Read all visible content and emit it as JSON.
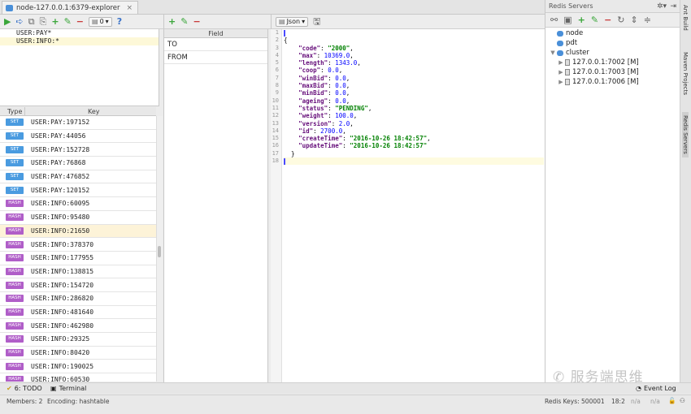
{
  "tab": {
    "title": "node-127.0.0.1:6379-explorer",
    "close": "×"
  },
  "left_toolbar": {
    "db_value": "0"
  },
  "patterns": [
    "USER:PAY*",
    "USER:INFO:*"
  ],
  "key_table": {
    "col_type": "Type",
    "col_key": "Key",
    "rows": [
      {
        "type": "SET",
        "key": "USER:PAY:197152"
      },
      {
        "type": "SET",
        "key": "USER:PAY:44056"
      },
      {
        "type": "SET",
        "key": "USER:PAY:152728"
      },
      {
        "type": "SET",
        "key": "USER:PAY:76868"
      },
      {
        "type": "SET",
        "key": "USER:PAY:476852"
      },
      {
        "type": "SET",
        "key": "USER:PAY:120152"
      },
      {
        "type": "HASH",
        "key": "USER:INFO:60095"
      },
      {
        "type": "HASH",
        "key": "USER:INFO:95480"
      },
      {
        "type": "HASH",
        "key": "USER:INFO:21650"
      },
      {
        "type": "HASH",
        "key": "USER:INFO:378370"
      },
      {
        "type": "HASH",
        "key": "USER:INFO:177955"
      },
      {
        "type": "HASH",
        "key": "USER:INFO:138815"
      },
      {
        "type": "HASH",
        "key": "USER:INFO:154720"
      },
      {
        "type": "HASH",
        "key": "USER:INFO:286820"
      },
      {
        "type": "HASH",
        "key": "USER:INFO:481640"
      },
      {
        "type": "HASH",
        "key": "USER:INFO:462980"
      },
      {
        "type": "HASH",
        "key": "USER:INFO:29325"
      },
      {
        "type": "HASH",
        "key": "USER:INFO:80420"
      },
      {
        "type": "HASH",
        "key": "USER:INFO:190025"
      },
      {
        "type": "HASH",
        "key": "USER:INFO:60530"
      }
    ]
  },
  "field_table": {
    "header": "Field",
    "rows": [
      "TO",
      "FROM"
    ]
  },
  "editor": {
    "format": "Json",
    "lines": [
      [
        [
          "p",
          "{"
        ]
      ],
      [
        [
          "p",
          "    "
        ],
        [
          "k",
          "\"code\""
        ],
        [
          "p",
          ": "
        ],
        [
          "s",
          "\"2000\""
        ],
        [
          "p",
          ","
        ]
      ],
      [
        [
          "p",
          "    "
        ],
        [
          "k",
          "\"max\""
        ],
        [
          "p",
          ": "
        ],
        [
          "n",
          "10369.0"
        ],
        [
          "p",
          ","
        ]
      ],
      [
        [
          "p",
          "    "
        ],
        [
          "k",
          "\"length\""
        ],
        [
          "p",
          ": "
        ],
        [
          "n",
          "1343.0"
        ],
        [
          "p",
          ","
        ]
      ],
      [
        [
          "p",
          "    "
        ],
        [
          "k",
          "\"coop\""
        ],
        [
          "p",
          ": "
        ],
        [
          "n",
          "0.0"
        ],
        [
          "p",
          ","
        ]
      ],
      [
        [
          "p",
          "    "
        ],
        [
          "k",
          "\"winBid\""
        ],
        [
          "p",
          ": "
        ],
        [
          "n",
          "0.0"
        ],
        [
          "p",
          ","
        ]
      ],
      [
        [
          "p",
          "    "
        ],
        [
          "k",
          "\"maxBid\""
        ],
        [
          "p",
          ": "
        ],
        [
          "n",
          "0.0"
        ],
        [
          "p",
          ","
        ]
      ],
      [
        [
          "p",
          "    "
        ],
        [
          "k",
          "\"minBid\""
        ],
        [
          "p",
          ": "
        ],
        [
          "n",
          "0.0"
        ],
        [
          "p",
          ","
        ]
      ],
      [
        [
          "p",
          "    "
        ],
        [
          "k",
          "\"ageing\""
        ],
        [
          "p",
          ": "
        ],
        [
          "n",
          "0.0"
        ],
        [
          "p",
          ","
        ]
      ],
      [
        [
          "p",
          "    "
        ],
        [
          "k",
          "\"status\""
        ],
        [
          "p",
          ": "
        ],
        [
          "s",
          "\"PENDING\""
        ],
        [
          "p",
          ","
        ]
      ],
      [
        [
          "p",
          "    "
        ],
        [
          "k",
          "\"weight\""
        ],
        [
          "p",
          ": "
        ],
        [
          "n",
          "100.0"
        ],
        [
          "p",
          ","
        ]
      ],
      [
        [
          "p",
          "    "
        ],
        [
          "k",
          "\"version\""
        ],
        [
          "p",
          ": "
        ],
        [
          "n",
          "2.0"
        ],
        [
          "p",
          ","
        ]
      ],
      [
        [
          "p",
          "    "
        ],
        [
          "k",
          "\"id\""
        ],
        [
          "p",
          ": "
        ],
        [
          "n",
          "2700.0"
        ],
        [
          "p",
          ","
        ]
      ],
      [
        [
          "p",
          "    "
        ],
        [
          "k",
          "\"createTime\""
        ],
        [
          "p",
          ": "
        ],
        [
          "s",
          "\"2016-10-26 18:42:57\""
        ],
        [
          "p",
          ","
        ]
      ],
      [
        [
          "p",
          "    "
        ],
        [
          "k",
          "\"updateTime\""
        ],
        [
          "p",
          ": "
        ],
        [
          "s",
          "\"2016-10-26 18:42:57\""
        ]
      ],
      [
        [
          "p",
          "  }"
        ]
      ],
      [
        [
          "p",
          ""
        ]
      ]
    ],
    "line_numbers": [
      "1",
      "2",
      "3",
      "4",
      "5",
      "6",
      "7",
      "8",
      "9",
      "10",
      "11",
      "12",
      "13",
      "14",
      "15",
      "16",
      "17",
      "18"
    ]
  },
  "redis_panel": {
    "title": "Redis Servers",
    "tree": [
      {
        "label": "node",
        "kind": "node",
        "indent": 0,
        "arrow": ""
      },
      {
        "label": "pdt",
        "kind": "node",
        "indent": 0,
        "arrow": ""
      },
      {
        "label": "cluster",
        "kind": "node",
        "indent": 0,
        "arrow": "▼"
      },
      {
        "label": "127.0.0.1:7002 [M]",
        "kind": "server",
        "indent": 1,
        "arrow": "▶"
      },
      {
        "label": "127.0.0.1:7003 [M]",
        "kind": "server",
        "indent": 1,
        "arrow": "▶"
      },
      {
        "label": "127.0.0.1:7006 [M]",
        "kind": "server",
        "indent": 1,
        "arrow": "▶"
      }
    ]
  },
  "side_tools": [
    "Ant Build",
    "Maven Projects",
    "Redis Servers"
  ],
  "tool_windows": {
    "todo": "6: TODO",
    "terminal": "Terminal",
    "event_log": "Event Log"
  },
  "status_bar": {
    "members": "Members: 2",
    "encoding": "Encoding: hashtable",
    "redis_keys": "Redis Keys: 500001",
    "position": "18:2",
    "na1": "n/a",
    "na2": "n/a"
  },
  "watermark": "服务端思维",
  "colors": {
    "set_badge": "#4a9be0",
    "hash_badge": "#b05ec8",
    "accent": "#3a72c8"
  }
}
